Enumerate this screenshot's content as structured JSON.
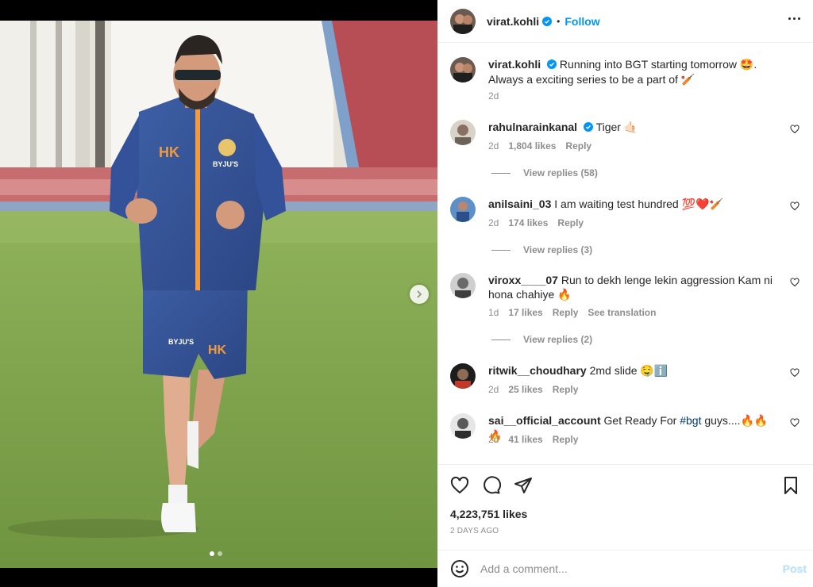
{
  "post": {
    "username": "virat.kohli",
    "follow_label": "Follow",
    "separator": "•",
    "caption_parts": [
      "Running into BGT starting tomorrow ",
      "🤩",
      ". Always a exciting series to be a part of ",
      "🏏"
    ],
    "caption_time": "2d",
    "likes": "4,223,751 likes",
    "date": "2 DAYS AGO"
  },
  "comments": [
    {
      "username": "rahulnaraink­anal",
      "text": "Tiger ",
      "emoji": "🤙🏻",
      "time": "2d",
      "likes": "1,804 likes",
      "reply": "Reply",
      "view_replies": "View replies (58)",
      "verified": true
    },
    {
      "username": "anilsaini_03",
      "text": "I am waiting test hundred ",
      "emoji": "💯❤️🏏",
      "time": "2d",
      "likes": "174 likes",
      "reply": "Reply",
      "view_replies": "View replies (3)"
    },
    {
      "username": "viroxx____07",
      "text": "Run to dekh lenge lekin aggression Kam ni hona chahiye ",
      "emoji": "🔥",
      "time": "1d",
      "likes": "17 likes",
      "reply": "Reply",
      "translate": "See translation",
      "view_replies": "View replies (2)"
    },
    {
      "username": "ritwik__choudhary",
      "text": "2md slide ",
      "emoji": "🤤ℹ️",
      "time": "2d",
      "likes": "25 likes",
      "reply": "Reply"
    },
    {
      "username": "sai__official_account",
      "text": "Get Ready For ",
      "hashtag": "#bgt",
      "text_after": " guys....",
      "emoji": "🔥🔥🔥",
      "time": "2d",
      "likes": "41 likes",
      "reply": "Reply"
    }
  ],
  "composer": {
    "placeholder": "Add a comment...",
    "post_label": "Post"
  },
  "icons": {
    "like": "heart-icon",
    "comment": "comment-icon",
    "share": "share-icon",
    "save": "bookmark-icon",
    "emoji": "smiley-icon",
    "more": "more-dots-icon",
    "verified": "verified-badge-icon",
    "next": "chevron-right-icon"
  },
  "carousel": {
    "slides": 2,
    "active": 1
  },
  "colors": {
    "link": "#0095f6",
    "verified": "#0095f6",
    "secondary_text": "#8e8e8e",
    "hashtag": "#00376b",
    "post_disabled": "#b2dffc"
  }
}
